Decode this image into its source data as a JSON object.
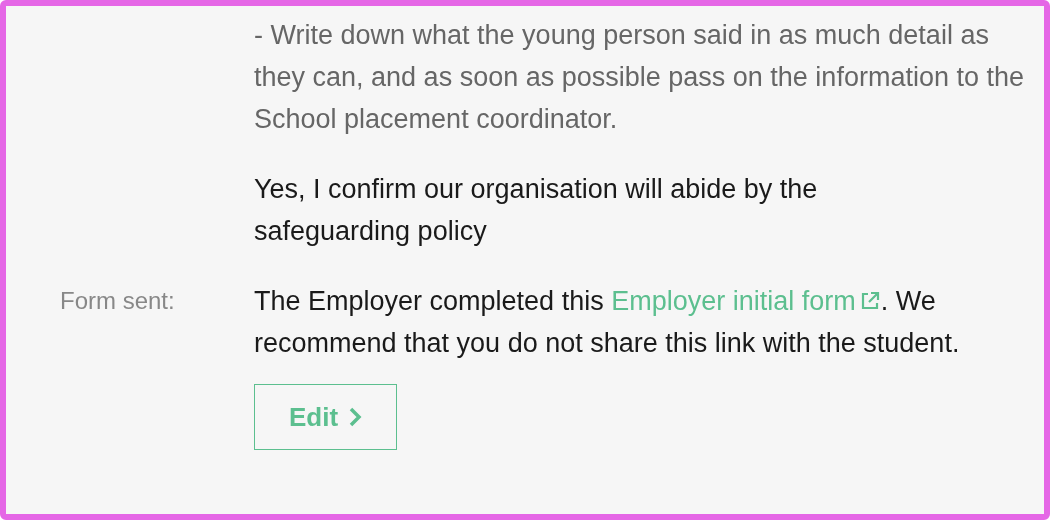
{
  "instruction_text": "- Write down what the young person said in as much detail as they can, and as soon as possible pass on the information to the School placement coordinator.",
  "confirmation_text": "Yes, I confirm our organisation will abide by the safeguarding policy",
  "form_sent": {
    "label": "Form sent:",
    "text_before": "The Employer completed this ",
    "link": "Employer initial form",
    "text_after": ". We recommend that you do not share this link with the student."
  },
  "edit_button": {
    "label": "Edit"
  }
}
